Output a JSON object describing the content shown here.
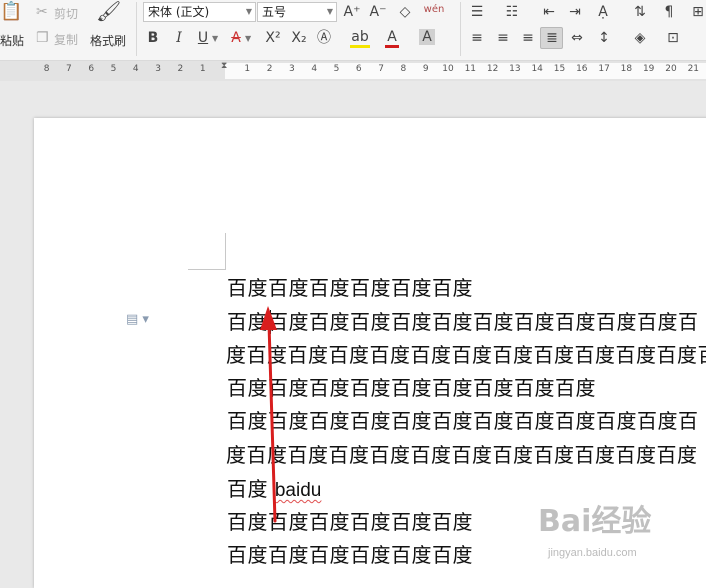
{
  "toolbar": {
    "paste_label": "粘贴",
    "cut_label": "剪切",
    "copy_label": "复制",
    "format_painter_label": "格式刷",
    "font_name": "宋体 (正文)",
    "font_size": "五号",
    "bold": "B",
    "italic": "I",
    "underline": "U",
    "strike": "A",
    "superscript": "X²",
    "subscript": "X₂",
    "grow_font": "A⁺",
    "shrink_font": "A⁻",
    "phonetic_guide": "wén"
  },
  "ruler": {
    "left_ticks": [
      "8",
      "7",
      "6",
      "5",
      "4",
      "3",
      "2",
      "1"
    ],
    "right_ticks": [
      "1",
      "2",
      "3",
      "4",
      "5",
      "6",
      "7",
      "8",
      "9",
      "10",
      "11",
      "12",
      "13",
      "14",
      "15",
      "16",
      "17",
      "18",
      "19",
      "20",
      "21"
    ]
  },
  "document": {
    "lines": [
      "百度百度百度百度百度百度",
      "百度百度百度百度百度百度百度百度百度百度百度百",
      "度百度百度百度百度百度百度百度百度百度百度百度百",
      "百度百度百度百度百度百度百度百度百度",
      "百度百度百度百度百度百度百度百度百度百度百度百",
      "度百度百度百度百度百度百度百度百度百度百度百度",
      "百度",
      "百度百度百度百度百度百度",
      "百度百度百度百度百度百度"
    ],
    "inline_word": "baidu"
  },
  "watermark": {
    "brand": "Bai经验",
    "url": "jingyan.baidu.com"
  },
  "colors": {
    "arrow": "#d81e1e",
    "squiggle": "#e05050"
  }
}
